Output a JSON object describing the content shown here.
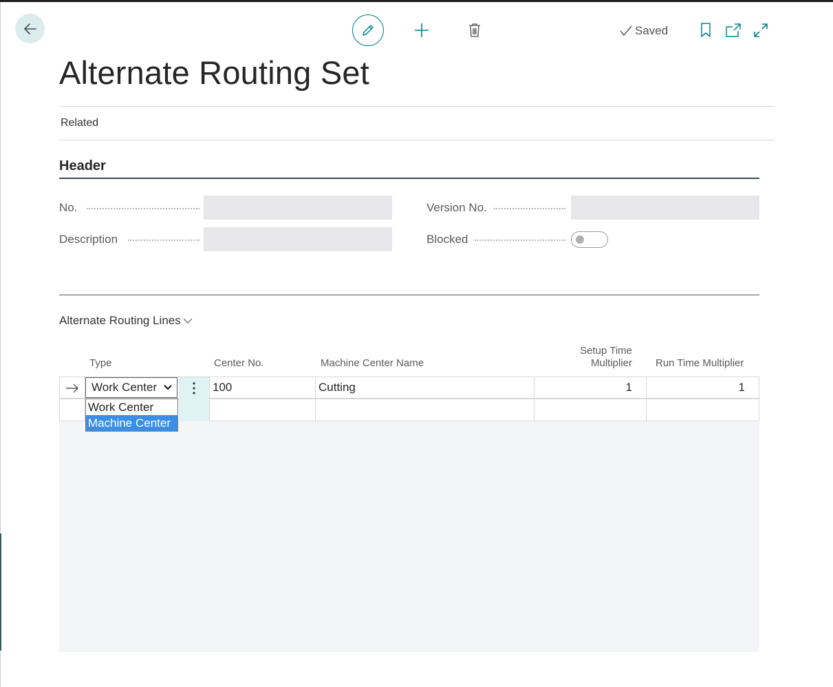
{
  "page": {
    "title": "Alternate Routing Set"
  },
  "toolbar": {
    "saved_label": "Saved"
  },
  "actions": {
    "related_label": "Related"
  },
  "header": {
    "section_title": "Header",
    "fields": {
      "no": {
        "label": "No.",
        "value": ""
      },
      "description": {
        "label": "Description",
        "value": ""
      },
      "version_no": {
        "label": "Version No.",
        "value": ""
      },
      "blocked": {
        "label": "Blocked",
        "value": false
      }
    }
  },
  "lines": {
    "title": "Alternate Routing Lines",
    "columns": {
      "type": "Type",
      "center_no": "Center No.",
      "machine_center_name": "Machine Center Name",
      "setup_time_multiplier_1": "Setup Time",
      "setup_time_multiplier_2": "Multiplier",
      "run_time_multiplier": "Run Time Multiplier"
    },
    "rows": [
      {
        "type": "Work Center",
        "center_no": "100",
        "machine_center_name": "Cutting",
        "setup_time_multiplier": "1",
        "run_time_multiplier": "1"
      },
      {
        "type": "",
        "center_no": "",
        "machine_center_name": "",
        "setup_time_multiplier": "",
        "run_time_multiplier": ""
      }
    ],
    "type_dropdown": {
      "options": [
        "Work Center",
        "Machine Center"
      ],
      "highlighted": "Machine Center"
    }
  },
  "icons": {
    "back": "arrow-left-icon",
    "edit": "pencil-icon",
    "new": "plus-icon",
    "delete": "trash-icon",
    "saved": "checkmark-icon",
    "bookmark": "bookmark-icon",
    "open_new_window": "open-in-new-window-icon",
    "expand": "expand-icon",
    "collapse": "chevron-down-icon",
    "row_indicator": "arrow-right-icon",
    "row_menu": "vertical-ellipsis-icon"
  },
  "colors": {
    "accent": "#00838f",
    "selection": "#3a8ee6",
    "back_button_bg": "#dcebee"
  }
}
